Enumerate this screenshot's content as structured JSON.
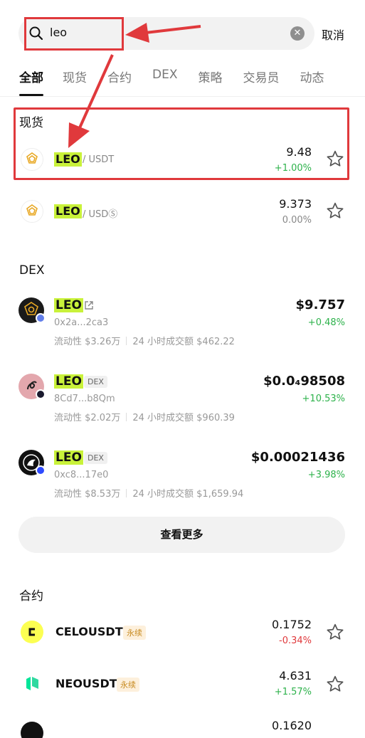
{
  "search": {
    "value": "leo",
    "cancel_label": "取消"
  },
  "tabs": [
    {
      "label": "全部",
      "active": true
    },
    {
      "label": "现货"
    },
    {
      "label": "合约"
    },
    {
      "label": "DEX"
    },
    {
      "label": "策略"
    },
    {
      "label": "交易员"
    },
    {
      "label": "动态"
    }
  ],
  "spot": {
    "title": "现货",
    "items": [
      {
        "symbol": "LEO",
        "quote": " / USDT",
        "price": "9.48",
        "change": "+1.00%"
      },
      {
        "symbol": "LEO",
        "quote": " / USDⓈ",
        "price": "9.373",
        "change": "0.00%"
      }
    ]
  },
  "dex": {
    "title": "DEX",
    "items": [
      {
        "symbol": "LEO",
        "address": "0x2a...2ca3",
        "liquidity": "流动性 $3.26万",
        "volume": "24 小时成交额 $462.22",
        "price": "$9.757",
        "change": "+0.48%"
      },
      {
        "symbol": "LEO",
        "tag": "DEX",
        "address": "8Cd7...b8Qm",
        "liquidity": "流动性 $2.02万",
        "volume": "24 小时成交额 $960.39",
        "price": "$0.0₄98508",
        "change": "+10.53%"
      },
      {
        "symbol": "LEO",
        "tag": "DEX",
        "address": "0xc8...17e0",
        "liquidity": "流动性 $8.53万",
        "volume": "24 小时成交额 $1,659.94",
        "price": "$0.00021436",
        "change": "+3.98%"
      }
    ],
    "more_label": "查看更多"
  },
  "futures": {
    "title": "合约",
    "items": [
      {
        "symbol": "CELOUSDT",
        "tag": "永续",
        "price": "0.1752",
        "change": "-0.34%"
      },
      {
        "symbol": "NEOUSDT",
        "tag": "永续",
        "price": "4.631",
        "change": "+1.57%"
      },
      {
        "price": "0.1620"
      }
    ]
  },
  "colors": {
    "highlight": "#c9f23a",
    "up": "#2db24b",
    "down": "#e0393c",
    "annotation": "#e0393c"
  }
}
